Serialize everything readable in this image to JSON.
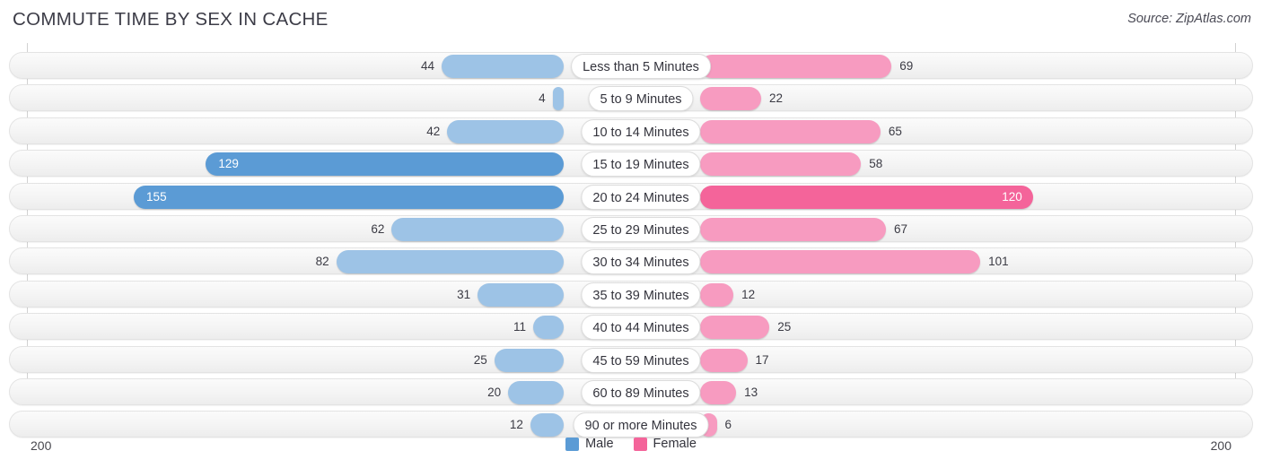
{
  "header": {
    "title": "COMMUTE TIME BY SEX IN CACHE",
    "source": "Source: ZipAtlas.com"
  },
  "axis": {
    "left_cap": "200",
    "right_cap": "200",
    "max": 200
  },
  "legend": {
    "items": [
      {
        "label": "Male",
        "color": "#5b9bd5",
        "name": "legend-male"
      },
      {
        "label": "Female",
        "color": "#f4649a",
        "name": "legend-female"
      }
    ]
  },
  "colors": {
    "male_light": "#9dc3e6",
    "male_dark": "#5b9bd5",
    "female_light": "#f79bc0",
    "female_dark": "#f4649a",
    "track": "#f4f4f4",
    "title": "#3c3c47"
  },
  "chart_data": {
    "type": "bar",
    "orientation": "horizontal-diverging",
    "title": "COMMUTE TIME BY SEX IN CACHE",
    "xlabel": "",
    "ylabel": "",
    "xlim": [
      -200,
      200
    ],
    "axis_max": 200,
    "grid": false,
    "legend_position": "bottom-center",
    "categories": [
      "Less than 5 Minutes",
      "5 to 9 Minutes",
      "10 to 14 Minutes",
      "15 to 19 Minutes",
      "20 to 24 Minutes",
      "25 to 29 Minutes",
      "30 to 34 Minutes",
      "35 to 39 Minutes",
      "40 to 44 Minutes",
      "45 to 59 Minutes",
      "60 to 89 Minutes",
      "90 or more Minutes"
    ],
    "series": [
      {
        "name": "Male",
        "side": "left",
        "color": "#9dc3e6",
        "values": [
          44,
          4,
          42,
          129,
          155,
          62,
          82,
          31,
          11,
          25,
          20,
          12
        ]
      },
      {
        "name": "Female",
        "side": "right",
        "color": "#f79bc0",
        "values": [
          69,
          22,
          65,
          58,
          120,
          67,
          101,
          12,
          25,
          17,
          13,
          6
        ]
      }
    ]
  }
}
